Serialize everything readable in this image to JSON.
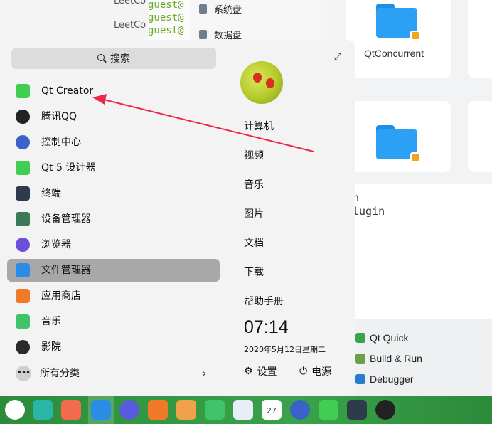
{
  "background": {
    "left_lines": [
      "LeetCo",
      "LeetCo"
    ],
    "terminal_lines": [
      "guest@",
      "guest@",
      "guest@"
    ],
    "files": [
      {
        "label": "系统盘",
        "icon": "drive-icon"
      },
      {
        "label": "数据盘",
        "icon": "drive-icon"
      }
    ],
    "folder_label": "QtConcurrent",
    "code_lines": [
      "n",
      "lugin"
    ],
    "project_items": [
      {
        "label": "Qt Quick",
        "color": "#3aa24a"
      },
      {
        "label": "Build & Run",
        "color": "#6aa04a"
      },
      {
        "label": "Debugger",
        "color": "#2a7ad0"
      }
    ]
  },
  "launcher": {
    "search_label": "搜索",
    "expand_icon": "expand-icon",
    "apps": [
      {
        "label": "Qt Creator",
        "icon": "qt-creator-icon",
        "color": "#41cd52",
        "selected": false
      },
      {
        "label": "腾讯QQ",
        "icon": "qq-icon",
        "color": "#222222",
        "selected": false
      },
      {
        "label": "控制中心",
        "icon": "control-center-icon",
        "color": "#3a62c9",
        "selected": false
      },
      {
        "label": "Qt 5 设计器",
        "icon": "qt-designer-icon",
        "color": "#41cd52",
        "selected": false
      },
      {
        "label": "终端",
        "icon": "terminal-icon",
        "color": "#2d3b4a",
        "selected": false
      },
      {
        "label": "设备管理器",
        "icon": "device-manager-icon",
        "color": "#3b7a57",
        "selected": false
      },
      {
        "label": "浏览器",
        "icon": "browser-icon",
        "color": "#6b4fd8",
        "selected": false
      },
      {
        "label": "文件管理器",
        "icon": "file-manager-icon",
        "color": "#2b8ce6",
        "selected": true
      },
      {
        "label": "应用商店",
        "icon": "app-store-icon",
        "color": "#f17a2a",
        "selected": false
      },
      {
        "label": "音乐",
        "icon": "music-icon",
        "color": "#3fc46a",
        "selected": false
      },
      {
        "label": "影院",
        "icon": "movie-icon",
        "color": "#2a2a2a",
        "selected": false
      }
    ],
    "all_categories_label": "所有分类",
    "places": [
      "计算机",
      "视频",
      "音乐",
      "图片",
      "文档",
      "下载",
      "帮助手册"
    ],
    "clock": "07:14",
    "date": "2020年5月12日星期二",
    "settings_label": "设置",
    "power_label": "电源"
  },
  "taskbar": {
    "icons": [
      {
        "name": "launcher-icon",
        "color": "#ffffff"
      },
      {
        "name": "multitask-view-icon",
        "color": "#28b6a8"
      },
      {
        "name": "workspace-icon",
        "color": "#f36b4c"
      },
      {
        "name": "file-manager-icon",
        "color": "#2b8ce6"
      },
      {
        "name": "browser-icon",
        "color": "#5a5ae0"
      },
      {
        "name": "app-store-icon",
        "color": "#f17a2a"
      },
      {
        "name": "image-viewer-icon",
        "color": "#f0a24a"
      },
      {
        "name": "music-icon",
        "color": "#3fc46a"
      },
      {
        "name": "document-viewer-icon",
        "color": "#e8eef7"
      },
      {
        "name": "calendar-icon",
        "color": "#ffffff"
      },
      {
        "name": "control-center-icon",
        "color": "#3a62c9"
      },
      {
        "name": "qt-creator-icon",
        "color": "#41cd52"
      },
      {
        "name": "terminal-icon",
        "color": "#2d3b4a"
      },
      {
        "name": "qq-icon",
        "color": "#222222"
      }
    ],
    "calendar_day": "27"
  },
  "annotation": {
    "color": "#e8294a"
  }
}
